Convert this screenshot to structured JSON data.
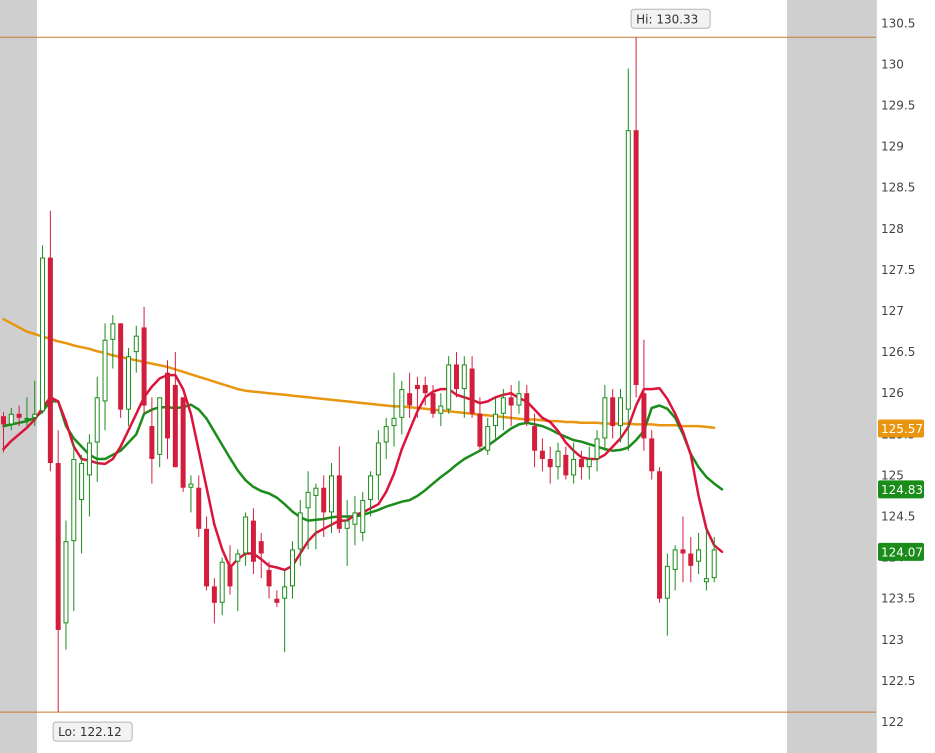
{
  "chart_data": {
    "type": "candlestick",
    "title": "",
    "xlabel": "",
    "ylabel": "",
    "ylim": [
      121.9,
      130.75
    ],
    "y_ticks": [
      122,
      122.5,
      123,
      123.5,
      124,
      124.5,
      125,
      125.5,
      126,
      126.5,
      127,
      127.5,
      128,
      128.5,
      129,
      129.5,
      130,
      130.5
    ],
    "y_tick_labels": [
      "122",
      "122.5",
      "123",
      "123.5",
      "124",
      "124.5",
      "125",
      "125.5",
      "126",
      "126.5",
      "127",
      "127.5",
      "128",
      "128.5",
      "129",
      "129.5",
      "130",
      "130.5"
    ],
    "grid": false,
    "colors": {
      "up": "#1a8c1a",
      "down": "#d21e3c",
      "sma_fast": "#dc143c",
      "sma_mid": "#1a8c1a",
      "sma_slow": "#e8960f",
      "hilo_line": "#c87832",
      "session_shade": "#cfcfcf"
    },
    "hi": {
      "label": "Hi: 130.33",
      "value": 130.33
    },
    "lo": {
      "label": "Lo: 122.12",
      "value": 122.12
    },
    "badges": [
      {
        "label": "125.57",
        "value": 125.57,
        "color": "#e8960f"
      },
      {
        "label": "124.83",
        "value": 124.83,
        "color": "#1a8c1a"
      },
      {
        "label": "124.07",
        "value": 124.07,
        "color": "#1a8c1a"
      }
    ],
    "candles": [
      [
        125.72,
        125.77,
        125.28,
        125.62
      ],
      [
        125.62,
        125.82,
        125.55,
        125.75
      ],
      [
        125.75,
        125.85,
        125.6,
        125.7
      ],
      [
        125.68,
        125.95,
        125.6,
        125.7
      ],
      [
        125.7,
        126.15,
        125.6,
        125.75
      ],
      [
        125.78,
        127.8,
        125.75,
        127.65
      ],
      [
        127.65,
        128.22,
        125.05,
        125.15
      ],
      [
        125.15,
        125.55,
        122.12,
        123.12
      ],
      [
        123.2,
        124.45,
        122.88,
        124.2
      ],
      [
        124.2,
        125.4,
        123.35,
        125.2
      ],
      [
        124.7,
        125.25,
        124.05,
        125.15
      ],
      [
        125.0,
        125.5,
        124.5,
        125.4
      ],
      [
        125.4,
        126.2,
        124.92,
        125.95
      ],
      [
        125.9,
        126.85,
        125.55,
        126.65
      ],
      [
        126.65,
        126.95,
        126.3,
        126.85
      ],
      [
        126.85,
        126.85,
        125.7,
        125.8
      ],
      [
        125.8,
        126.55,
        125.6,
        126.45
      ],
      [
        126.5,
        126.82,
        126.25,
        126.7
      ],
      [
        126.8,
        127.05,
        125.75,
        125.85
      ],
      [
        125.6,
        125.95,
        124.9,
        125.2
      ],
      [
        125.25,
        125.95,
        125.1,
        125.95
      ],
      [
        126.25,
        126.4,
        125.2,
        125.45
      ],
      [
        126.1,
        126.5,
        125.1,
        125.1
      ],
      [
        125.95,
        125.95,
        124.8,
        124.85
      ],
      [
        124.85,
        125.0,
        124.55,
        124.9
      ],
      [
        124.85,
        125.0,
        124.25,
        124.35
      ],
      [
        124.35,
        124.5,
        123.6,
        123.65
      ],
      [
        123.65,
        123.75,
        123.2,
        123.45
      ],
      [
        123.45,
        124.0,
        123.3,
        123.95
      ],
      [
        123.9,
        124.15,
        123.55,
        123.65
      ],
      [
        123.95,
        124.1,
        123.35,
        124.05
      ],
      [
        124.05,
        124.55,
        123.9,
        124.5
      ],
      [
        124.45,
        124.6,
        123.8,
        123.95
      ],
      [
        124.2,
        124.3,
        123.75,
        124.05
      ],
      [
        123.85,
        123.95,
        123.5,
        123.65
      ],
      [
        123.5,
        123.6,
        123.4,
        123.45
      ],
      [
        123.5,
        123.85,
        122.85,
        123.65
      ],
      [
        123.65,
        124.2,
        123.5,
        124.1
      ],
      [
        124.1,
        124.7,
        123.9,
        124.55
      ],
      [
        124.6,
        125.05,
        124.1,
        124.8
      ],
      [
        124.75,
        124.9,
        124.1,
        124.85
      ],
      [
        124.85,
        125.0,
        124.25,
        124.55
      ],
      [
        124.55,
        125.15,
        124.3,
        125.0
      ],
      [
        125.0,
        125.35,
        124.3,
        124.35
      ],
      [
        124.35,
        124.7,
        123.9,
        124.45
      ],
      [
        124.4,
        124.75,
        124.15,
        124.55
      ],
      [
        124.3,
        124.8,
        124.2,
        124.7
      ],
      [
        124.7,
        125.05,
        124.5,
        125.0
      ],
      [
        125.0,
        125.55,
        124.7,
        125.4
      ],
      [
        125.4,
        125.7,
        125.2,
        125.6
      ],
      [
        125.6,
        126.25,
        125.35,
        125.7
      ],
      [
        125.7,
        126.15,
        125.5,
        126.05
      ],
      [
        126.0,
        126.25,
        125.7,
        125.85
      ],
      [
        126.1,
        126.2,
        125.7,
        126.05
      ],
      [
        126.1,
        126.2,
        125.85,
        126.0
      ],
      [
        126.0,
        126.1,
        125.7,
        125.75
      ],
      [
        125.75,
        126.0,
        125.6,
        125.85
      ],
      [
        125.8,
        126.45,
        125.75,
        126.35
      ],
      [
        126.35,
        126.5,
        125.95,
        126.05
      ],
      [
        126.05,
        126.45,
        125.7,
        126.35
      ],
      [
        126.3,
        126.45,
        125.7,
        125.75
      ],
      [
        125.75,
        125.95,
        125.3,
        125.35
      ],
      [
        125.3,
        125.7,
        125.25,
        125.6
      ],
      [
        125.6,
        125.95,
        125.45,
        125.75
      ],
      [
        125.75,
        126.05,
        125.55,
        125.95
      ],
      [
        125.95,
        126.1,
        125.6,
        125.85
      ],
      [
        125.85,
        126.15,
        125.75,
        126.0
      ],
      [
        126.0,
        126.1,
        125.6,
        125.65
      ],
      [
        125.6,
        125.75,
        125.1,
        125.3
      ],
      [
        125.3,
        125.45,
        125.05,
        125.2
      ],
      [
        125.2,
        125.35,
        124.9,
        125.1
      ],
      [
        125.1,
        125.4,
        124.95,
        125.3
      ],
      [
        125.25,
        125.35,
        124.95,
        125.0
      ],
      [
        125.0,
        125.4,
        124.9,
        125.2
      ],
      [
        125.2,
        125.3,
        124.95,
        125.1
      ],
      [
        125.1,
        125.35,
        124.95,
        125.2
      ],
      [
        125.2,
        125.55,
        125.05,
        125.45
      ],
      [
        125.45,
        126.1,
        125.3,
        125.95
      ],
      [
        125.95,
        126.05,
        125.45,
        125.6
      ],
      [
        125.6,
        126.05,
        125.4,
        125.95
      ],
      [
        125.8,
        129.95,
        125.3,
        129.2
      ],
      [
        129.2,
        130.33,
        125.95,
        126.1
      ],
      [
        126.0,
        126.65,
        125.3,
        125.45
      ],
      [
        125.45,
        125.55,
        124.95,
        125.05
      ],
      [
        125.05,
        125.1,
        123.45,
        123.5
      ],
      [
        123.5,
        124.05,
        123.05,
        123.9
      ],
      [
        123.85,
        124.15,
        123.6,
        124.1
      ],
      [
        124.1,
        124.5,
        123.7,
        124.05
      ],
      [
        124.05,
        124.25,
        123.7,
        123.9
      ],
      [
        123.95,
        124.3,
        123.8,
        124.1
      ],
      [
        123.7,
        124.35,
        123.6,
        123.75
      ],
      [
        123.75,
        124.25,
        123.7,
        124.1
      ]
    ],
    "series": [
      {
        "key": "sma_slow",
        "values": [
          126.9,
          126.85,
          126.8,
          126.75,
          126.72,
          126.69,
          126.66,
          126.63,
          126.61,
          126.58,
          126.56,
          126.54,
          126.51,
          126.49,
          126.46,
          126.44,
          126.42,
          126.4,
          126.38,
          126.36,
          126.34,
          126.32,
          126.29,
          126.26,
          126.23,
          126.2,
          126.17,
          126.14,
          126.11,
          126.08,
          126.05,
          126.03,
          126.02,
          126.01,
          126.0,
          125.99,
          125.98,
          125.97,
          125.96,
          125.95,
          125.94,
          125.93,
          125.92,
          125.91,
          125.9,
          125.89,
          125.88,
          125.87,
          125.86,
          125.85,
          125.84,
          125.84,
          125.83,
          125.82,
          125.81,
          125.8,
          125.79,
          125.78,
          125.77,
          125.76,
          125.75,
          125.74,
          125.73,
          125.72,
          125.71,
          125.7,
          125.69,
          125.68,
          125.68,
          125.67,
          125.66,
          125.66,
          125.65,
          125.65,
          125.64,
          125.64,
          125.64,
          125.63,
          125.63,
          125.63,
          125.63,
          125.62,
          125.62,
          125.62,
          125.61,
          125.61,
          125.61,
          125.6,
          125.6,
          125.6,
          125.59,
          125.58
        ]
      },
      {
        "key": "sma_mid",
        "values": [
          125.6,
          125.62,
          125.64,
          125.66,
          125.7,
          125.78,
          125.9,
          125.9,
          125.6,
          125.45,
          125.35,
          125.25,
          125.2,
          125.2,
          125.25,
          125.3,
          125.4,
          125.5,
          125.75,
          125.8,
          125.83,
          125.83,
          125.82,
          125.83,
          125.86,
          125.8,
          125.69,
          125.53,
          125.37,
          125.21,
          125.06,
          124.94,
          124.86,
          124.81,
          124.78,
          124.73,
          124.65,
          124.56,
          124.49,
          124.45,
          124.46,
          124.47,
          124.49,
          124.5,
          124.5,
          124.5,
          124.52,
          124.55,
          124.58,
          124.62,
          124.65,
          124.68,
          124.7,
          124.75,
          124.82,
          124.9,
          124.98,
          125.05,
          125.13,
          125.2,
          125.25,
          125.3,
          125.36,
          125.43,
          125.5,
          125.57,
          125.62,
          125.64,
          125.62,
          125.6,
          125.56,
          125.51,
          125.47,
          125.43,
          125.41,
          125.38,
          125.35,
          125.32,
          125.3,
          125.31,
          125.34,
          125.43,
          125.54,
          125.82,
          125.85,
          125.81,
          125.7,
          125.5,
          125.26,
          125.1,
          124.98,
          124.9,
          124.83
        ]
      },
      {
        "key": "sma_fast",
        "values": [
          125.32,
          125.42,
          125.5,
          125.58,
          125.68,
          125.82,
          125.95,
          125.9,
          125.65,
          125.35,
          125.2,
          125.18,
          125.15,
          125.14,
          125.2,
          125.35,
          125.55,
          125.75,
          125.95,
          126.08,
          126.18,
          126.22,
          126.22,
          126.05,
          125.75,
          125.3,
          124.85,
          124.4,
          124.1,
          123.88,
          123.98,
          124.05,
          124.05,
          123.98,
          123.9,
          123.88,
          123.85,
          123.9,
          124.05,
          124.2,
          124.3,
          124.35,
          124.4,
          124.45,
          124.45,
          124.52,
          124.55,
          124.6,
          124.65,
          124.8,
          125.02,
          125.32,
          125.55,
          125.78,
          125.95,
          126.02,
          126.05,
          126.05,
          125.98,
          125.95,
          125.92,
          125.88,
          125.9,
          125.95,
          125.98,
          126.0,
          125.94,
          125.9,
          125.8,
          125.7,
          125.65,
          125.54,
          125.4,
          125.3,
          125.22,
          125.2,
          125.2,
          125.25,
          125.35,
          125.45,
          125.59,
          125.85,
          126.05,
          126.05,
          126.06,
          125.93,
          125.75,
          125.53,
          125.25,
          124.75,
          124.35,
          124.15,
          124.07
        ]
      }
    ]
  }
}
